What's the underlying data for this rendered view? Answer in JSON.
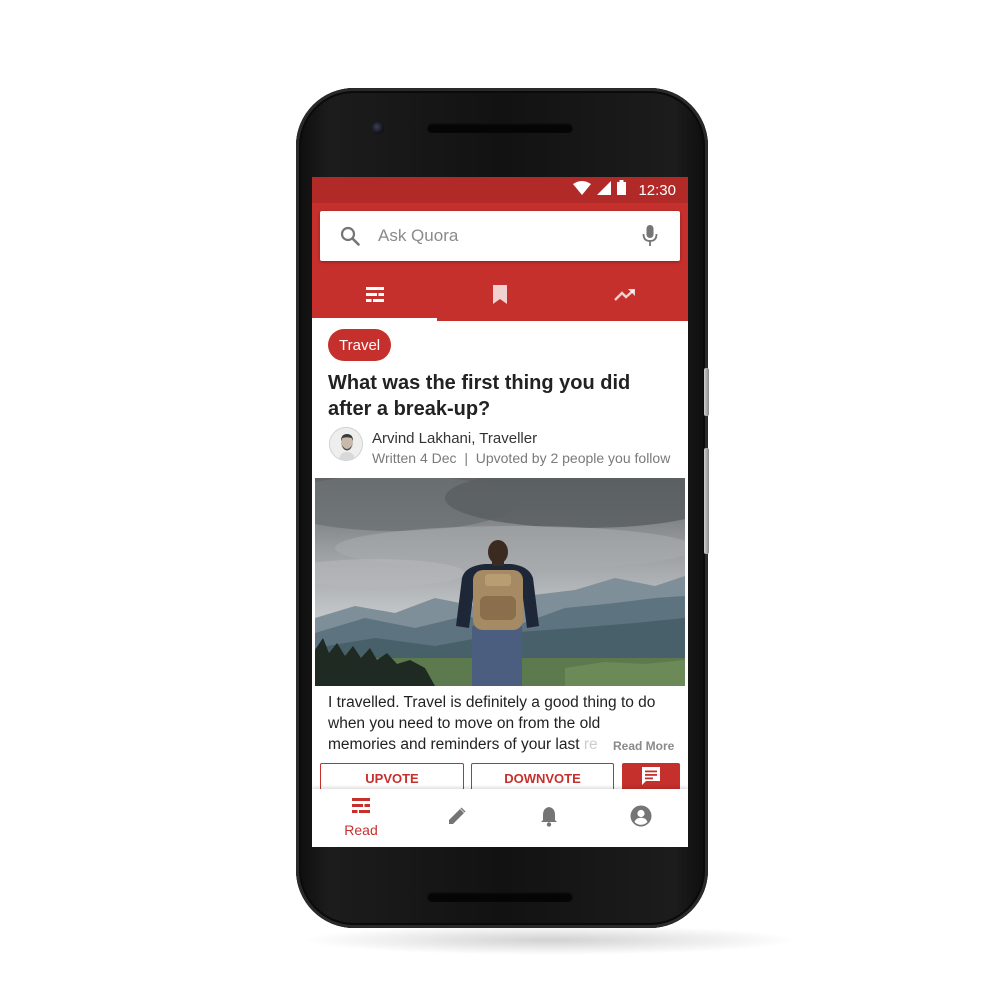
{
  "status_bar": {
    "time": "12:30"
  },
  "search": {
    "placeholder": "Ask Quora"
  },
  "top_tabs": [
    {
      "icon": "feed-icon",
      "active": true
    },
    {
      "icon": "bookmark-icon",
      "active": false
    },
    {
      "icon": "trending-icon",
      "active": false
    }
  ],
  "post": {
    "topic": "Travel",
    "question": "What was the first thing you did after a break-up?",
    "author_name": "Arvind Lakhani, Traveller",
    "author_meta": "Written 4 Dec  |  Upvoted by 2 people you follow",
    "answer_lines": [
      "I travelled. Travel is definitely a good thing to do",
      "when you need to move on from the old",
      "memories and reminders of your last "
    ],
    "answer_faded": "re",
    "read_more": "Read More",
    "upvote_label": "UPVOTE",
    "downvote_label": "DOWNVOTE"
  },
  "bottom_nav": {
    "read_label": "Read",
    "items": [
      "read-icon",
      "write-icon",
      "notifications-icon",
      "profile-icon"
    ]
  },
  "colors": {
    "brand": "#c5302d",
    "status_bar": "#b12a27"
  }
}
